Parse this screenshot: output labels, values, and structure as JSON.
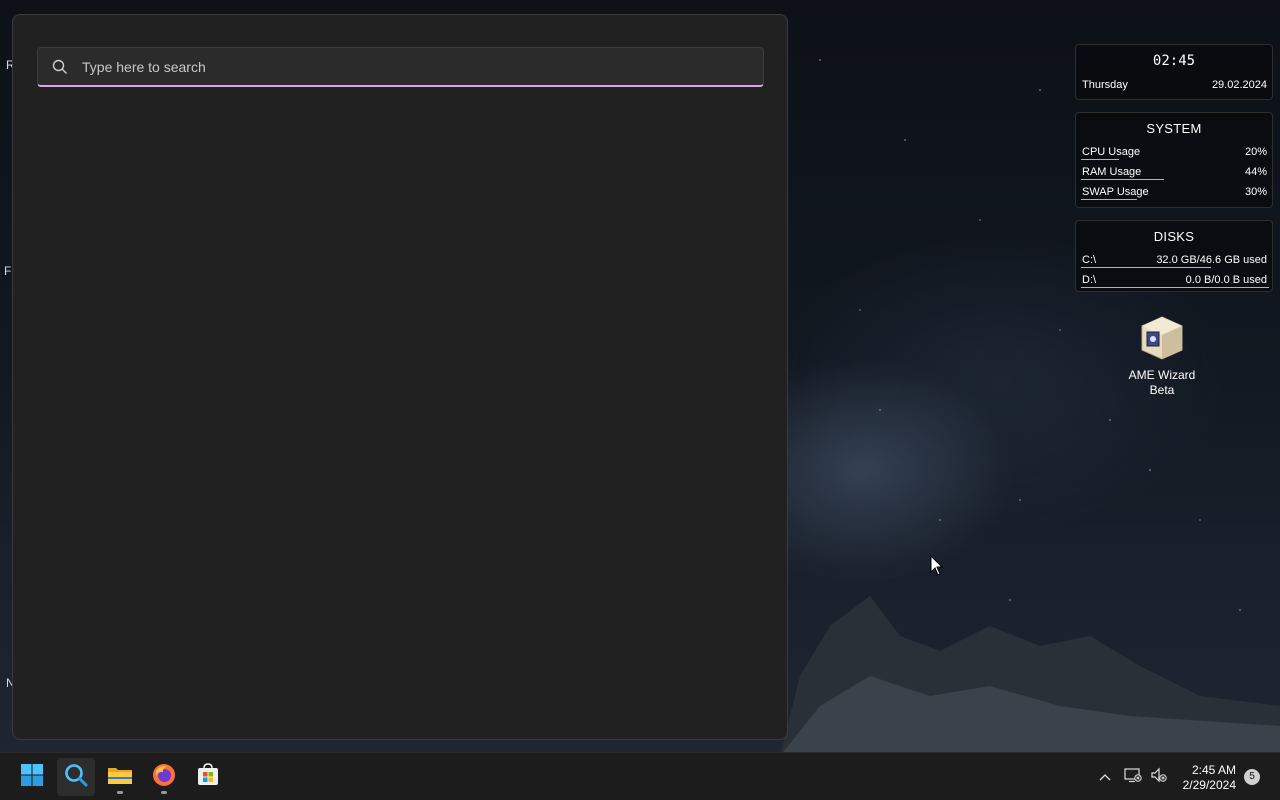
{
  "search": {
    "placeholder": "Type here to search"
  },
  "clock_widget": {
    "time": "02:45",
    "day": "Thursday",
    "date": "29.02.2024"
  },
  "system_widget": {
    "title": "SYSTEM",
    "metrics": [
      {
        "label": "CPU Usage",
        "value": "20%",
        "fraction": 0.2
      },
      {
        "label": "RAM Usage",
        "value": "44%",
        "fraction": 0.44
      },
      {
        "label": "SWAP Usage",
        "value": "30%",
        "fraction": 0.3
      }
    ]
  },
  "disks_widget": {
    "title": "DISKS",
    "disks": [
      {
        "label": "C:\\",
        "value": "32.0 GB/46.6 GB used",
        "fraction": 0.69
      },
      {
        "label": "D:\\",
        "value": "0.0 B/0.0 B used",
        "fraction": 1.0
      }
    ]
  },
  "desktop": {
    "icons": [
      {
        "label": "AME Wizard Beta",
        "icon": "ame-wizard-icon"
      }
    ],
    "edge_letters": [
      "R",
      "Fi",
      "N"
    ]
  },
  "taskbar": {
    "apps": [
      {
        "name": "start",
        "icon": "windows-logo-icon"
      },
      {
        "name": "search",
        "icon": "search-icon"
      },
      {
        "name": "file-explorer",
        "icon": "folder-icon"
      },
      {
        "name": "firefox",
        "icon": "firefox-icon"
      },
      {
        "name": "microsoft-store",
        "icon": "store-icon"
      }
    ],
    "clock_time": "2:45 AM",
    "clock_date": "2/29/2024",
    "notification_count": "5"
  },
  "colors": {
    "accent_bar": "#e8a56a",
    "search_underline": "#d9a7e6",
    "panel_bg": "#212121",
    "taskbar_bg": "#1c1c1c"
  }
}
